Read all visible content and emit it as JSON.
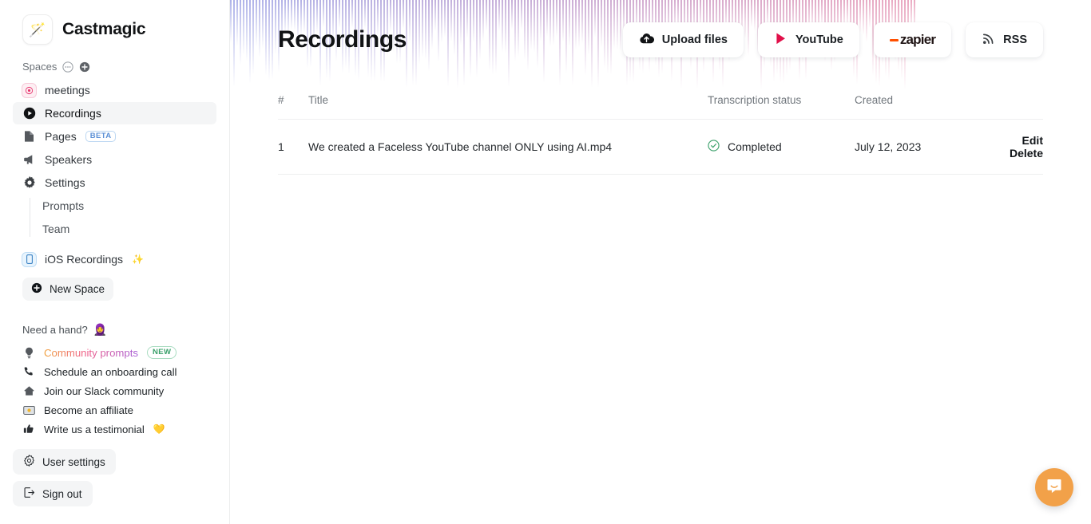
{
  "app": {
    "brand_name": "Castmagic",
    "brand_logo_glyph": "🪄"
  },
  "sidebar": {
    "spaces_label": "Spaces",
    "spaces_menu_icon": "ellipsis-circle-icon",
    "spaces_add_icon": "plus-circle-icon",
    "nav": [
      {
        "label": "meetings",
        "icon": "record-target-icon",
        "active": false
      },
      {
        "label": "Recordings",
        "icon": "play-circle-icon",
        "active": true
      },
      {
        "label": "Pages",
        "icon": "document-icon",
        "badge": "BETA",
        "active": false
      },
      {
        "label": "Speakers",
        "icon": "megaphone-icon",
        "active": false
      },
      {
        "label": "Settings",
        "icon": "gear-icon",
        "active": false
      }
    ],
    "subnav": [
      {
        "label": "Prompts"
      },
      {
        "label": "Team"
      }
    ],
    "ios": {
      "label": "iOS Recordings",
      "emoji": "✨",
      "icon": "phone-icon"
    },
    "new_space": {
      "label": "New Space",
      "icon": "plus-circle-icon"
    },
    "help": {
      "heading": "Need a hand?",
      "heading_emoji": "🧕",
      "items": [
        {
          "label": "Community prompts",
          "icon": "lightbulb-icon",
          "badge": "NEW",
          "gradient": true
        },
        {
          "label": "Schedule an onboarding call",
          "icon": "phone-call-icon"
        },
        {
          "label": "Join our Slack community",
          "icon": "house-icon"
        },
        {
          "label": "Become an affiliate",
          "icon": "banknote-icon"
        },
        {
          "label": "Write us a testimonial",
          "icon": "thumbs-up-icon",
          "emoji": "💛"
        }
      ]
    },
    "bottom": [
      {
        "label": "User settings",
        "icon": "gear-icon"
      },
      {
        "label": "Sign out",
        "icon": "sign-out-icon"
      }
    ]
  },
  "header": {
    "title": "Recordings",
    "buttons": [
      {
        "label": "Upload files",
        "icon": "cloud-upload-icon"
      },
      {
        "label": "YouTube",
        "icon": "youtube-play-icon"
      },
      {
        "label": "zapier",
        "icon": "zapier-logo"
      },
      {
        "label": "RSS",
        "icon": "rss-icon"
      }
    ]
  },
  "table": {
    "columns": [
      "#",
      "Title",
      "Transcription status",
      "Created",
      ""
    ],
    "rows": [
      {
        "num": "1",
        "title": "We created a Faceless YouTube channel ONLY using AI.mp4",
        "status": "Completed",
        "status_icon": "check-circle-icon",
        "created": "July 12, 2023",
        "edit_label": "Edit",
        "delete_label": "Delete"
      }
    ]
  },
  "widgets": {
    "intercom_label": "chat-bubble-icon"
  },
  "colors": {
    "accent_pink": "#e8376f",
    "zapier_orange": "#ff4f00",
    "status_green": "#3aa06a",
    "intercom_orange": "#f2a149",
    "wave_left": "#a9aee8",
    "wave_right": "#e9a3bd"
  }
}
